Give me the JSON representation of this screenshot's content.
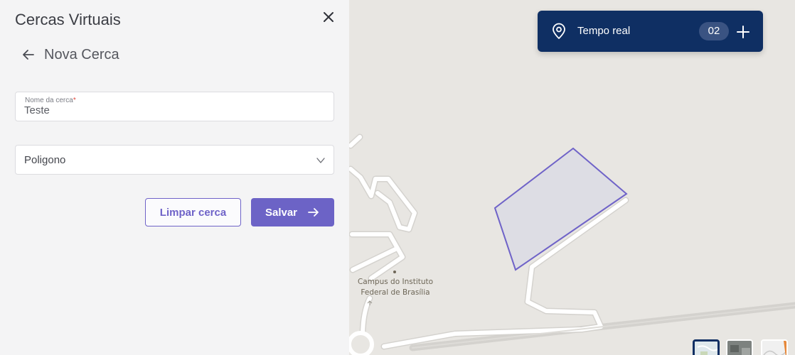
{
  "panel": {
    "title": "Cercas Virtuais",
    "subtitle": "Nova Cerca",
    "icons": {
      "close": "close-icon",
      "back": "arrow-left-icon",
      "dropdown": "chevron-down-icon",
      "save": "arrow-right-icon"
    },
    "name_field": {
      "label": "Nome da cerca",
      "required_mark": "*",
      "value": "Teste"
    },
    "type_select": {
      "value": "Poligono"
    },
    "buttons": {
      "clear": "Limpar cerca",
      "save": "Salvar"
    }
  },
  "realtime": {
    "label": "Tempo real",
    "count": "02",
    "icons": {
      "pin": "location-pin-icon",
      "add": "plus-icon"
    }
  },
  "map": {
    "poi_label_line1": "Campus do Instituto",
    "poi_label_line2": "Federal de Brasília",
    "layer_thumbnails": [
      "map-layer",
      "satellite-layer",
      "terrain-layer"
    ]
  },
  "colors": {
    "accent": "#6c63c6",
    "navy": "#0f2f63",
    "panel_bg": "#f4f4f5",
    "map_bg": "#e8e6e2",
    "fence_stroke": "#6f63c8",
    "required": "#e2483d"
  }
}
